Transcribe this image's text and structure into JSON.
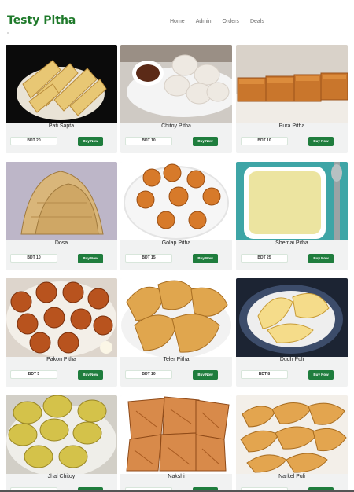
{
  "brand": {
    "title": "Testy Pitha"
  },
  "nav": {
    "items": [
      "Home",
      "Admin",
      "Orders",
      "Deals"
    ]
  },
  "products": [
    {
      "name": "Pati Sapta",
      "price": "BDT 20",
      "buy_label": "Buy Now",
      "icon": "pati-sapta-image"
    },
    {
      "name": "Chitoy Pitha",
      "price": "BDT 10",
      "buy_label": "Buy Now",
      "icon": "chitoy-pitha-image"
    },
    {
      "name": "Pura Pitha",
      "price": "BDT 10",
      "buy_label": "Buy Now",
      "icon": "pura-pitha-image"
    },
    {
      "name": "Dosa",
      "price": "BDT 10",
      "buy_label": "Buy Now",
      "icon": "dosa-image"
    },
    {
      "name": "Golap Pitha",
      "price": "BDT 15",
      "buy_label": "Buy Now",
      "icon": "golap-pitha-image"
    },
    {
      "name": "Shemai Pitha",
      "price": "BDT 25",
      "buy_label": "Buy Now",
      "icon": "shemai-pitha-image"
    },
    {
      "name": "Pakon Pitha",
      "price": "BDT 5",
      "buy_label": "Buy Now",
      "icon": "pakon-pitha-image"
    },
    {
      "name": "Teler Pitha",
      "price": "BDT 10",
      "buy_label": "Buy Now",
      "icon": "teler-pitha-image"
    },
    {
      "name": "Dudh Puli",
      "price": "BDT 8",
      "buy_label": "Buy Now",
      "icon": "dudh-puli-image"
    },
    {
      "name": "Jhal Chitoy",
      "price": "",
      "buy_label": "",
      "icon": "jhal-chitoy-image"
    },
    {
      "name": "Nakshi",
      "price": "",
      "buy_label": "",
      "icon": "nakshi-pitha-image"
    },
    {
      "name": "Narkel Puli",
      "price": "",
      "buy_label": "",
      "icon": "narkel-puli-image"
    }
  ],
  "colors": {
    "brand": "#1f7a2b",
    "buy_button": "#1f7d3d",
    "card_bg": "#f1f2f2"
  }
}
